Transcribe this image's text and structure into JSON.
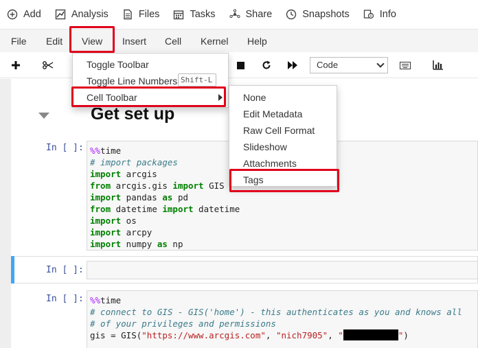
{
  "appbar": {
    "items": [
      {
        "label": "Add",
        "icon": "plus-circle-icon"
      },
      {
        "label": "Analysis",
        "icon": "chart-icon"
      },
      {
        "label": "Files",
        "icon": "document-icon"
      },
      {
        "label": "Tasks",
        "icon": "calendar-icon"
      },
      {
        "label": "Share",
        "icon": "share-icon"
      },
      {
        "label": "Snapshots",
        "icon": "clock-icon"
      },
      {
        "label": "Info",
        "icon": "info-icon"
      }
    ]
  },
  "menubar": {
    "items": [
      "File",
      "Edit",
      "View",
      "Insert",
      "Cell",
      "Kernel",
      "Help"
    ]
  },
  "toolbar": {
    "cell_type": "Code",
    "buttons": [
      "add-cell-icon",
      "cut-icon",
      "stop-icon",
      "restart-icon",
      "run-all-icon",
      "keyboard-icon",
      "chart-icon"
    ]
  },
  "view_menu": {
    "items": [
      {
        "label": "Toggle Toolbar"
      },
      {
        "label": "Toggle Line Numbers",
        "shortcut": "Shift-L"
      },
      {
        "label": "Cell Toolbar"
      }
    ]
  },
  "cell_toolbar_menu": {
    "items": [
      "None",
      "Edit Metadata",
      "Raw Cell Format",
      "Slideshow",
      "Attachments",
      "Tags"
    ]
  },
  "notebook": {
    "heading": "Get set up",
    "cells": [
      {
        "prompt": "In [ ]:",
        "lines": [
          "%%time",
          "# import packages",
          "import arcgis",
          "from arcgis.gis import GIS",
          "import pandas as pd",
          "from datetime import datetime",
          "import os",
          "import arcpy",
          "import numpy as np"
        ]
      },
      {
        "prompt": "In [ ]:",
        "lines": []
      },
      {
        "prompt": "In [ ]:",
        "lines": [
          "%%time",
          "# connect to GIS - GIS('home') - this authenticates as you and knows all",
          "# of your privileges and permissions",
          "gis = GIS(\"https://www.arcgis.com\", \"nich7905\", \"\")"
        ]
      }
    ]
  },
  "colors": {
    "highlight": "#e0001b",
    "active_cell": "#42a5f5",
    "keyword": "#008000",
    "comment": "#3b7b8a",
    "string": "#ba2121",
    "magic": "#aa22ff"
  }
}
